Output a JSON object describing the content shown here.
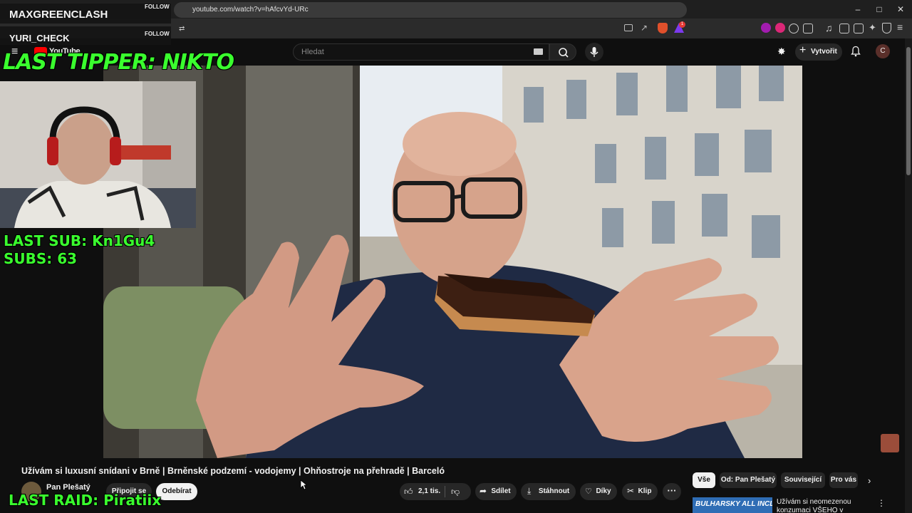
{
  "browser": {
    "url": "youtube.com/watch?v=hAfcvYd-URc",
    "extension_badge_count": "1"
  },
  "youtube": {
    "logo_text": "YouTube",
    "search_placeholder": "Hledat",
    "create_label": "Vytvořit",
    "avatar_letter": "C"
  },
  "overlay": {
    "follower1": "MAXGREENCLASH",
    "follower2": "YURI_CHECK",
    "follow_label": "FOLLOW",
    "last_tipper": "LAST TIPPER: NIKTO",
    "last_sub": "LAST SUB: Kn1Gu4",
    "subs": "SUBS: 63",
    "last_raid": "LAST RAID: Piratiix"
  },
  "video": {
    "title": "Užívám si luxusní snídani v Brně | Brněnské podzemí - vodojemy | Ohňostroje na přehradě | Barceló"
  },
  "channel": {
    "name": "Pan Plešatý",
    "join_label": "Připojit se",
    "subscribe_label": "Odebírat"
  },
  "actions": {
    "likes": "2,1 tis.",
    "share": "Sdílet",
    "download": "Stáhnout",
    "thanks": "Díky",
    "clip": "Klip"
  },
  "chips": [
    "Vše",
    "Od: Pan Plešatý",
    "Související",
    "Pro vás"
  ],
  "recommendation": {
    "thumb_text": "BULHARSKY ALL INCLUSIVE",
    "title_line1": "Užívám si neomezenou",
    "title_line2": "konzumaci VŠEHO v"
  }
}
